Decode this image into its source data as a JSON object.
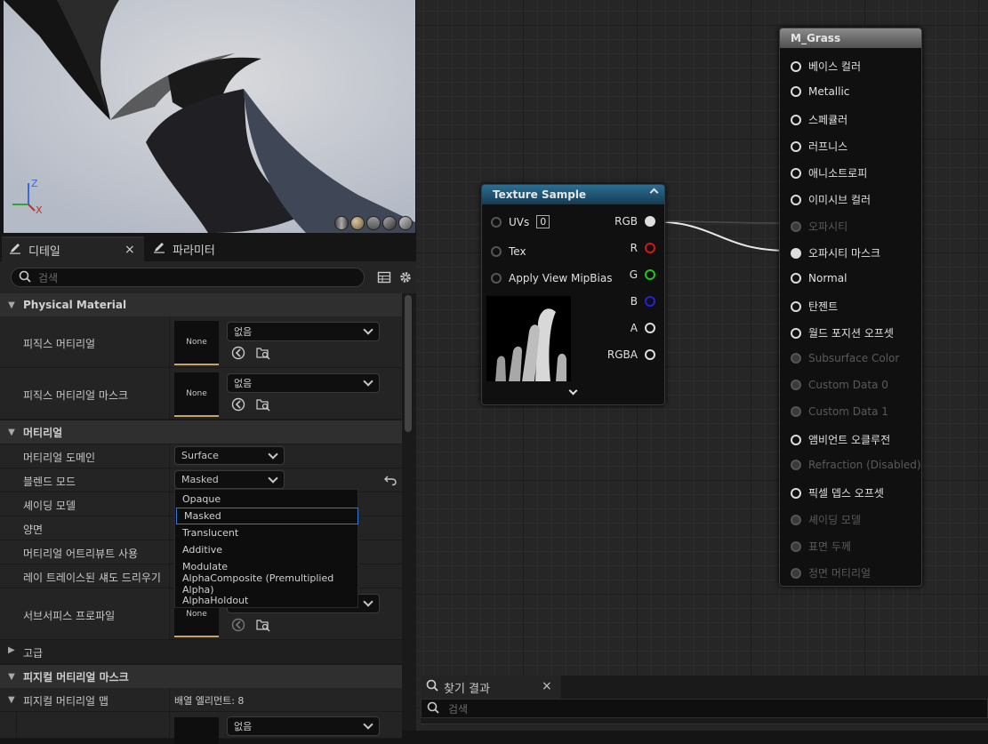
{
  "viewport": {
    "axis_z": "Z",
    "axis_x": "X"
  },
  "details_panel": {
    "tab_details": "디테일",
    "tab_close": "×",
    "tab_params": "파라미터",
    "search_placeholder": "검색",
    "sections": {
      "physical_material": "Physical Material",
      "material": "머티리얼",
      "advanced": "고급",
      "physical_material_mask": "피지컬 머티리얼 마스크"
    },
    "rows": {
      "phys_material": "피직스 머티리얼",
      "phys_material_mask": "피직스 머티리얼 마스크",
      "material_domain": "머티리얼 도메인",
      "blend_mode": "블렌드 모드",
      "shading_model": "셰이딩 모델",
      "two_sided": "양면",
      "use_material_attributes": "머티리얼 어트리뷰트 사용",
      "ray_traced_shadows": "레이 트레이스된 섀도 드리우기",
      "subsurface_profile": "서브서피스 프로파일",
      "phys_material_map": "피지컬 머티리얼 맵"
    },
    "values": {
      "none_thumb": "None",
      "none_combo": "없음",
      "material_domain": "Surface",
      "blend_mode": "Masked",
      "array_elements": "배열 엘리먼트: 8"
    }
  },
  "blend_dropdown": {
    "options": [
      "Opaque",
      "Masked",
      "Translucent",
      "Additive",
      "Modulate",
      "AlphaComposite (Premultiplied Alpha)",
      "AlphaHoldout"
    ],
    "selected": "Masked"
  },
  "texture_node": {
    "title": "Texture Sample",
    "inputs": [
      "UVs",
      "Tex",
      "Apply View MipBias"
    ],
    "uv_value": "0",
    "outputs": [
      "RGB",
      "R",
      "G",
      "B",
      "A",
      "RGBA"
    ],
    "output_colors": [
      "#e0e0e0",
      "#d01818",
      "#1fc41f",
      "#2222d8",
      "#d8d8d8",
      "#d8d8d8"
    ]
  },
  "material_node": {
    "title": "M_Grass",
    "pins": [
      {
        "label": "베이스 컬러",
        "enabled": true,
        "connected": false
      },
      {
        "label": "Metallic",
        "enabled": true,
        "connected": false
      },
      {
        "label": "스페큘러",
        "enabled": true,
        "connected": false
      },
      {
        "label": "러프니스",
        "enabled": true,
        "connected": false
      },
      {
        "label": "애니소트로피",
        "enabled": true,
        "connected": false
      },
      {
        "label": "이미시브 컬러",
        "enabled": true,
        "connected": false
      },
      {
        "label": "오파시티",
        "enabled": false,
        "connected": false
      },
      {
        "label": "오파시티 마스크",
        "enabled": true,
        "connected": true
      },
      {
        "label": "Normal",
        "enabled": true,
        "connected": false
      },
      {
        "label": "탄젠트",
        "enabled": true,
        "connected": false
      },
      {
        "label": "월드 포지션 오프셋",
        "enabled": true,
        "connected": false
      },
      {
        "label": "Subsurface Color",
        "enabled": false,
        "connected": false
      },
      {
        "label": "Custom Data 0",
        "enabled": false,
        "connected": false
      },
      {
        "label": "Custom Data 1",
        "enabled": false,
        "connected": false
      },
      {
        "label": "앰비언트 오클루전",
        "enabled": true,
        "connected": false
      },
      {
        "label": "Refraction (Disabled)",
        "enabled": false,
        "connected": false
      },
      {
        "label": "픽셀 뎁스 오프셋",
        "enabled": true,
        "connected": false
      },
      {
        "label": "셰이딩 모델",
        "enabled": false,
        "connected": false
      },
      {
        "label": "표면 두께",
        "enabled": false,
        "connected": false
      },
      {
        "label": "정면 머티리얼",
        "enabled": false,
        "connected": false
      }
    ]
  },
  "find_results": {
    "tab_label": "찾기 결과",
    "tab_close": "×",
    "search_placeholder": "검색"
  }
}
